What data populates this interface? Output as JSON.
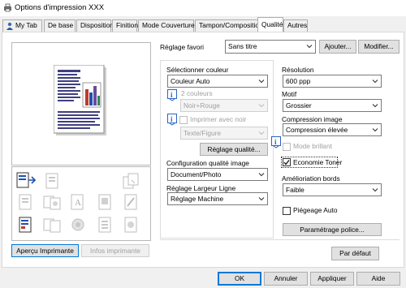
{
  "window": {
    "title": "Options d'impression XXX"
  },
  "tabs": [
    {
      "label": "My Tab",
      "active": false
    },
    {
      "label": "De base",
      "active": false
    },
    {
      "label": "Disposition",
      "active": false
    },
    {
      "label": "Finition",
      "active": false
    },
    {
      "label": "Mode Couverture",
      "active": false
    },
    {
      "label": "Tampon/Composition",
      "active": false
    },
    {
      "label": "Qualité",
      "active": true
    },
    {
      "label": "Autres",
      "active": false
    }
  ],
  "favorites": {
    "label": "Réglage favori",
    "value": "Sans titre",
    "add_label": "Ajouter...",
    "edit_label": "Modifier..."
  },
  "color": {
    "label": "Sélectionner couleur",
    "value": "Couleur Auto",
    "two_colors_label": "2 couleurs",
    "two_colors_value": "Noir+Rouge",
    "print_black_label": "Imprimer avec noir",
    "print_black_value": "Texte/Figure",
    "quality_settings_label": "Réglage qualité..."
  },
  "quality_config": {
    "label": "Configuration qualité image",
    "value": "Document/Photo"
  },
  "line_width": {
    "label": "Réglage Largeur Ligne",
    "value": "Réglage Machine"
  },
  "resolution": {
    "label": "Résolution",
    "value": "600 ppp"
  },
  "pattern": {
    "label": "Motif",
    "value": "Grossier"
  },
  "compression": {
    "label": "Compression image",
    "value": "Compression élevée"
  },
  "glossy_mode": {
    "label": "Mode brillant",
    "checked": false,
    "enabled": false
  },
  "toner_save": {
    "label": "Economie Toner",
    "checked": true
  },
  "edge": {
    "label": "Amélioriation bords",
    "value": "Faible"
  },
  "auto_trapping": {
    "label": "Piégeage Auto",
    "checked": false
  },
  "font_settings_label": "Paramétrage police...",
  "default_label": "Par défaut",
  "preview": {
    "printer_view_label": "Aperçu Imprimante",
    "printer_info_label": "Infos imprimante"
  },
  "dialog": {
    "ok_label": "OK",
    "cancel_label": "Annuler",
    "apply_label": "Appliquer",
    "help_label": "Aide"
  },
  "colors": {
    "accent": "#0078d7",
    "check": "#1a1a1a"
  }
}
